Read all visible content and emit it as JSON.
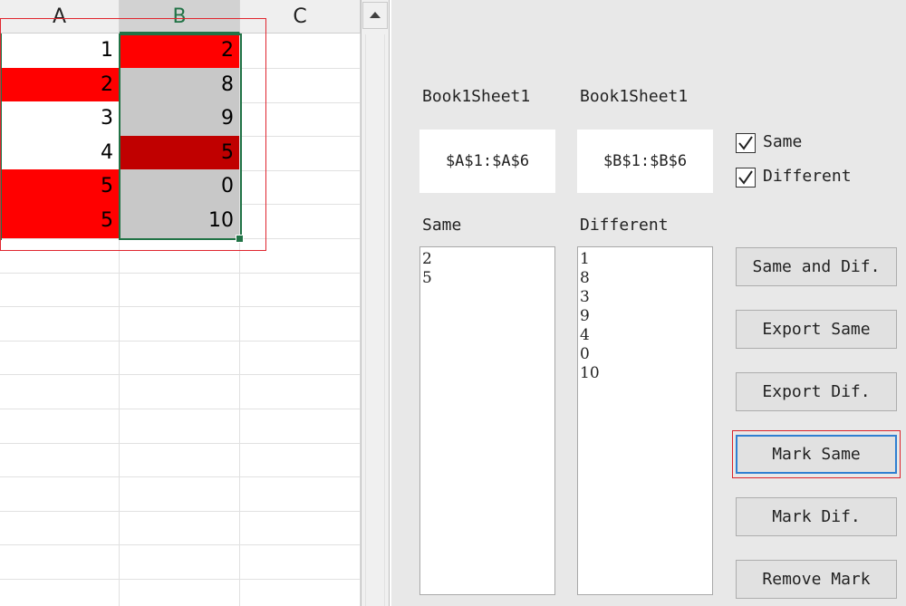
{
  "sheet": {
    "columns": [
      "A",
      "B",
      "C"
    ],
    "rows": [
      {
        "a": "1",
        "b": "2",
        "a_bg": "#ffffff",
        "b_bg": "#ff0000"
      },
      {
        "a": "2",
        "b": "8",
        "a_bg": "#ff0000",
        "b_bg": "#c8c8c8"
      },
      {
        "a": "3",
        "b": "9",
        "a_bg": "#ffffff",
        "b_bg": "#c8c8c8"
      },
      {
        "a": "4",
        "b": "5",
        "a_bg": "#ffffff",
        "b_bg": "#c00000"
      },
      {
        "a": "5",
        "b": "0",
        "a_bg": "#ff0000",
        "b_bg": "#c8c8c8"
      },
      {
        "a": "5",
        "b": "10",
        "a_bg": "#ff0000",
        "b_bg": "#c8c8c8"
      }
    ]
  },
  "dialog": {
    "source1_label": "Book1Sheet1",
    "source2_label": "Book1Sheet1",
    "range1": "$A$1:$A$6",
    "range2": "$B$1:$B$6",
    "check_same_label": "Same",
    "check_same_checked": true,
    "check_diff_label": "Different",
    "check_diff_checked": true,
    "same_list_label": "Same",
    "diff_list_label": "Different",
    "same_items": [
      "2",
      "5"
    ],
    "diff_items": [
      "1",
      "8",
      "3",
      "9",
      "4",
      "0",
      "10"
    ],
    "buttons": {
      "same_and_dif": "Same and Dif.",
      "export_same": "Export Same",
      "export_dif": "Export Dif.",
      "mark_same": "Mark Same",
      "mark_dif": "Mark Dif.",
      "remove_mark": "Remove Mark"
    }
  },
  "colors": {
    "mark_red": "#ff0000",
    "dark_red": "#c00000",
    "selection_green": "#217346",
    "highlight_border": "#d9222a",
    "focus_blue": "#2f7fd1"
  }
}
